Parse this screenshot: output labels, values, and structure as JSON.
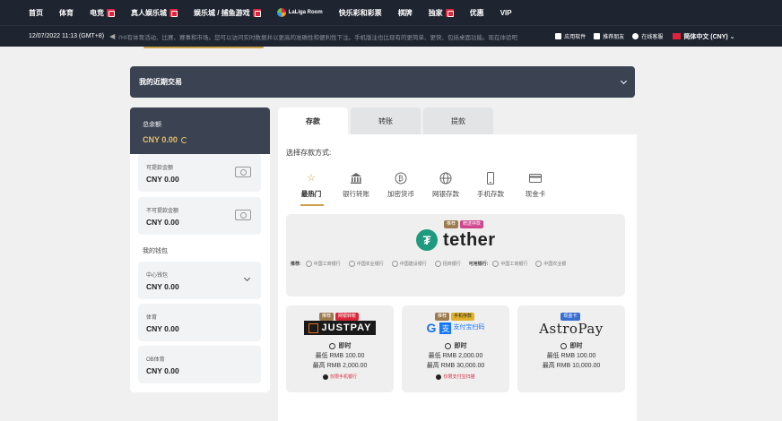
{
  "top_nav": {
    "items": [
      {
        "label": "首页"
      },
      {
        "label": "体育"
      },
      {
        "label": "电竞",
        "hot": true
      },
      {
        "label": "真人娱乐城",
        "hot": true
      },
      {
        "label": "娱乐城 / 捕鱼游戏",
        "hot": true
      },
      {
        "label": "快乐彩和彩票"
      },
      {
        "label": "棋牌"
      },
      {
        "label": "独家",
        "hot": true
      },
      {
        "label": "优惠"
      },
      {
        "label": "VIP"
      }
    ],
    "laliga_label": "LaLiga Room"
  },
  "info_bar": {
    "datetime": "12/07/2022 11:13 (GMT+8)",
    "announcement": "l'HI有体育活动、比赛、赛事和市场。您可以访问实时数据并以更高的准确性和便利性下注。手机版注也比现有的更简单、更快、包括桌面功能。现在体验吧",
    "tools": [
      "应用软件",
      "推荐朋友",
      "在线客服"
    ],
    "language": "简体中文 (CNY)"
  },
  "recent_transactions": {
    "label": "我的近期交易"
  },
  "wallet": {
    "total_label": "总余额",
    "total_value": "CNY 0.00",
    "withdrawable": {
      "label": "可提款金额",
      "value": "CNY 0.00"
    },
    "non_withdrawable": {
      "label": "不可提款金额",
      "value": "CNY 0.00"
    },
    "my_wallets_label": "我的钱包",
    "wallets": [
      {
        "label": "中心钱包",
        "value": "CNY 0.00"
      },
      {
        "label": "体育",
        "value": "CNY 0.00"
      },
      {
        "label": "OB体育",
        "value": "CNY 0.00"
      }
    ]
  },
  "tabs": [
    {
      "label": "存款",
      "active": true
    },
    {
      "label": "转账"
    },
    {
      "label": "提款"
    }
  ],
  "deposit": {
    "choose_label": "选择存款方式:",
    "methods": [
      {
        "label": "最热门",
        "icon": "star-icon",
        "active": true
      },
      {
        "label": "银行转账",
        "icon": "bank-icon"
      },
      {
        "label": "加密货币",
        "icon": "bitcoin-icon"
      },
      {
        "label": "网银存款",
        "icon": "globe-icon"
      },
      {
        "label": "手机存款",
        "icon": "mobile-icon"
      },
      {
        "label": "现金卡",
        "icon": "card-icon"
      }
    ],
    "tether": {
      "badges": [
        "推荐",
        "赠送存款"
      ],
      "name": "tether",
      "tag_left": "推荐:",
      "tag_mid": "可用银行:",
      "banks": [
        "中国工商银行",
        "中国农业银行",
        "中国建设银行",
        "招商银行",
        "中国工商银行",
        "中国农业银"
      ]
    },
    "providers": [
      {
        "badges": [
          "推荐",
          "网银转帐"
        ],
        "name": "JUSTPAY",
        "instant": "即时",
        "min": "最低 RMB 100.00",
        "max": "最高 RMB 2,000.00",
        "note": "仅限手机银行"
      },
      {
        "badges": [
          "推荐",
          "手机存款"
        ],
        "name": "支付宝扫码",
        "instant": "即时",
        "min": "最低 RMB 2,000.00",
        "max": "最高 RMB 30,000.00",
        "note": "仅限支付宝扫描"
      },
      {
        "badges": [
          "现金卡"
        ],
        "name": "AstroPay",
        "instant": "即时",
        "min": "最低 RMB 100.00",
        "max": "最高 RMB 10,000.00"
      }
    ]
  }
}
